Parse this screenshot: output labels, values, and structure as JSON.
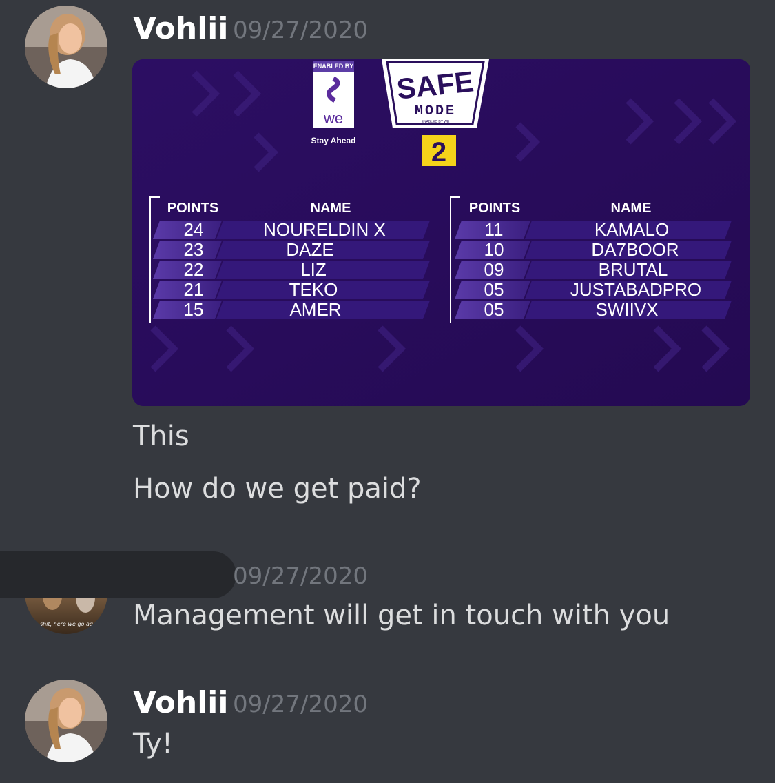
{
  "messages": [
    {
      "author": "Vohlii",
      "timestamp": "09/27/2020",
      "embed": {
        "sponsor_tag": "ENABLED BY",
        "sponsor_logo_text": "we",
        "sponsor_tagline": "Stay Ahead",
        "event_title_line1": "SAFE",
        "event_title_line2": "MODE",
        "event_subtitle": "ENABLED BY WE",
        "event_number": "2",
        "left_table": {
          "headers": [
            "POINTS",
            "NAME"
          ],
          "rows": [
            {
              "points": "24",
              "name": "NOURELDIN X"
            },
            {
              "points": "23",
              "name": "DAZE"
            },
            {
              "points": "22",
              "name": "LIZ"
            },
            {
              "points": "21",
              "name": "TEKO"
            },
            {
              "points": "15",
              "name": "AMER"
            }
          ]
        },
        "right_table": {
          "headers": [
            "POINTS",
            "NAME"
          ],
          "rows": [
            {
              "points": "11",
              "name": "KAMALO"
            },
            {
              "points": "10",
              "name": "DA7BOOR"
            },
            {
              "points": "09",
              "name": "BRUTAL"
            },
            {
              "points": "05",
              "name": "JUSTABADPRO"
            },
            {
              "points": "05",
              "name": "SWIIVX"
            }
          ]
        }
      },
      "lines": [
        "This",
        "How do we get paid?"
      ]
    },
    {
      "author": "",
      "timestamp": "09/27/2020",
      "avatar_caption": "shit, here we go again",
      "lines": [
        "Management will get in touch with you"
      ]
    },
    {
      "author": "Vohlii",
      "timestamp": "09/27/2020",
      "lines": [
        "Ty!"
      ]
    }
  ],
  "colors": {
    "background": "#36393f",
    "text": "#dcddde",
    "muted": "#72767d",
    "embed_bg": "#2a0f5c",
    "accent_yellow": "#f5d31a"
  }
}
